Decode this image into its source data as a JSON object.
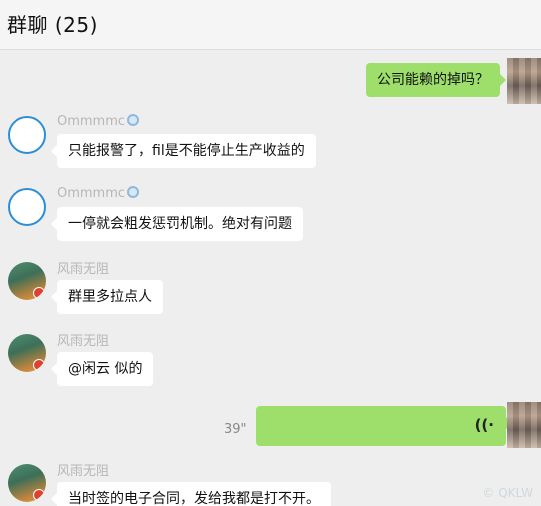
{
  "header": {
    "title": "群聊 (25)"
  },
  "messages": [
    {
      "from": "me",
      "type": "text",
      "text": "公司能赖的掉吗？"
    },
    {
      "from": "Ommmmc",
      "type": "text",
      "text": "只能报警了，fil是不能停止生产收益的"
    },
    {
      "from": "Ommmmc",
      "type": "text",
      "text": "一停就会粗发惩罚机制。绝对有问题"
    },
    {
      "from": "风雨无阻",
      "type": "text",
      "text": "群里多拉点人"
    },
    {
      "from": "风雨无阻",
      "type": "text",
      "text": "@闲云 似的"
    },
    {
      "from": "me",
      "type": "voice",
      "duration": "39\"",
      "icon": "voice-wave-icon"
    },
    {
      "from": "风雨无阻",
      "type": "text",
      "text": "当时签的电子合同，发给我都是打不开。"
    }
  ],
  "watermark": {
    "text": "© QKLW"
  },
  "colors": {
    "outgoing_bubble": "#9ddf6a",
    "incoming_bubble": "#ffffff",
    "background": "#eeeeee"
  }
}
